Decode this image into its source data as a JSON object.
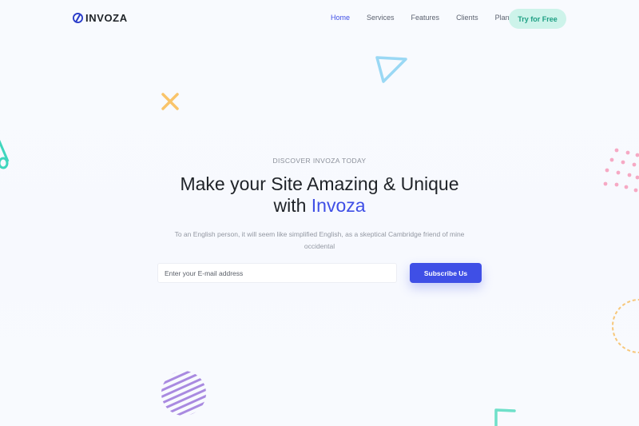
{
  "brand": {
    "name": "INVOZA",
    "icon": "brand-logo-icon"
  },
  "nav": {
    "items": [
      {
        "label": "Home",
        "active": true
      },
      {
        "label": "Services",
        "active": false
      },
      {
        "label": "Features",
        "active": false
      },
      {
        "label": "Clients",
        "active": false
      },
      {
        "label": "Plans",
        "active": false
      }
    ],
    "cta_label": "Try for Free"
  },
  "hero": {
    "eyebrow": "DISCOVER INVOZA TODAY",
    "title_line1": "Make your Site Amazing & Unique",
    "title_line2_prefix": "with ",
    "title_line2_brand": "Invoza",
    "description": "To an English person, it will seem like simplified English, as a skeptical Cambridge friend of mine occidental"
  },
  "subscribe": {
    "placeholder": "Enter your E-mail address",
    "value": "",
    "button_label": "Subscribe Us"
  },
  "colors": {
    "accent": "#3f4fe6",
    "cta_background": "#cdf3ea",
    "cta_text": "#1e9f84",
    "page_background": "#f7f9fe"
  },
  "decorations": [
    "triangle-outline-shape",
    "cross-shape",
    "teal-cone-shape",
    "pink-dots-pattern",
    "dashed-circle-shape",
    "striped-circle-shape",
    "corner-triangle-shape"
  ]
}
